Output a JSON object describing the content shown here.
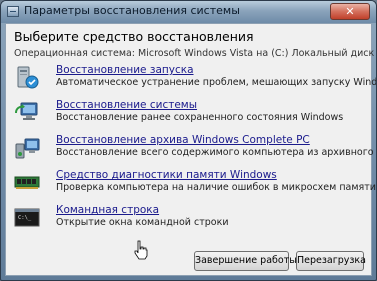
{
  "window": {
    "title": "Параметры восстановления системы",
    "close_icon": "close-icon"
  },
  "main": {
    "heading": "Выберите средство восстановления",
    "os_line": "Операционная система: Microsoft Windows Vista на (C:) Локальный диск",
    "items": [
      {
        "label": "Восстановление запуска",
        "description": "Автоматическое устранение проблем, мешающих запуску Windows",
        "icon": "startup-repair-icon"
      },
      {
        "label": "Восстановление системы",
        "description": "Восстановление ранее сохраненного состояния Windows",
        "icon": "system-restore-icon"
      },
      {
        "label": "Восстановление архива Windows Complete PC",
        "description": "Восстановление всего содержимого компьютера из архивного образа",
        "icon": "complete-pc-restore-icon"
      },
      {
        "label": "Средство диагностики памяти Windows",
        "description": "Проверка компьютера на наличие ошибок в микросхем памяти",
        "icon": "memory-diagnostic-icon"
      },
      {
        "label": "Командная строка",
        "description": "Открытие окна командной строки",
        "icon": "command-prompt-icon"
      }
    ]
  },
  "buttons": {
    "shutdown": "Завершение работы",
    "restart": "Перезагрузка"
  },
  "colors": {
    "link": "#1a1a8c",
    "client_bg": "#f0f0f0",
    "frame": "#6f8aa6"
  }
}
